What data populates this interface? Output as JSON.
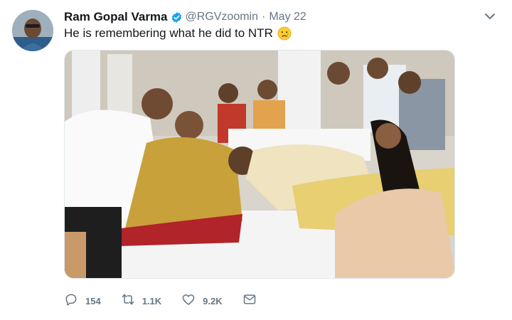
{
  "tweet": {
    "author_name": "Ram Gopal Varma",
    "handle": "@RGVzoomin",
    "separator": "·",
    "date": "May 22",
    "text": "He is remembering what he did to NTR",
    "emoji": "crying-face-icon",
    "verified": true
  },
  "actions": {
    "reply_count": "154",
    "retweet_count": "1.1K",
    "like_count": "9.2K"
  },
  "colors": {
    "text_primary": "#14171a",
    "text_secondary": "#657786",
    "verified_blue": "#1da1f2",
    "border": "#e1e8ed"
  }
}
